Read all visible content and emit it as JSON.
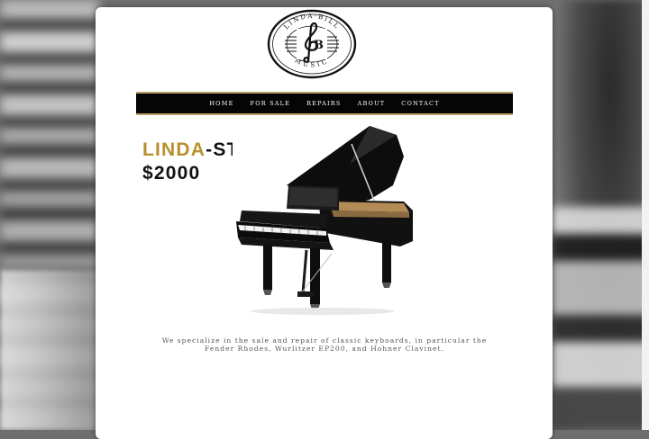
{
  "logo": {
    "top_text": "LINDA·BILL",
    "bottom_text": "MUSIC",
    "monogram": "B"
  },
  "nav": {
    "items": [
      {
        "label": "HOME"
      },
      {
        "label": "FOR SALE"
      },
      {
        "label": "REPAIRS"
      },
      {
        "label": "ABOUT"
      },
      {
        "label": "CONTACT"
      }
    ]
  },
  "headline": {
    "brand": "LINDA",
    "suffix": "-STORE",
    "price": "$2000"
  },
  "tagline": "We specialize in the sale and repair of classic keyboards, in particular the Fender Rhodes, Wurlitzer EP200, and Hohner Clavinet.",
  "colors": {
    "accent_gold": "#b8902f",
    "nav_bg": "#050505",
    "nav_border": "#b8a06a"
  },
  "icons": {
    "logo": "treble-clef-b-monogram",
    "piano": "grand-piano-image"
  }
}
